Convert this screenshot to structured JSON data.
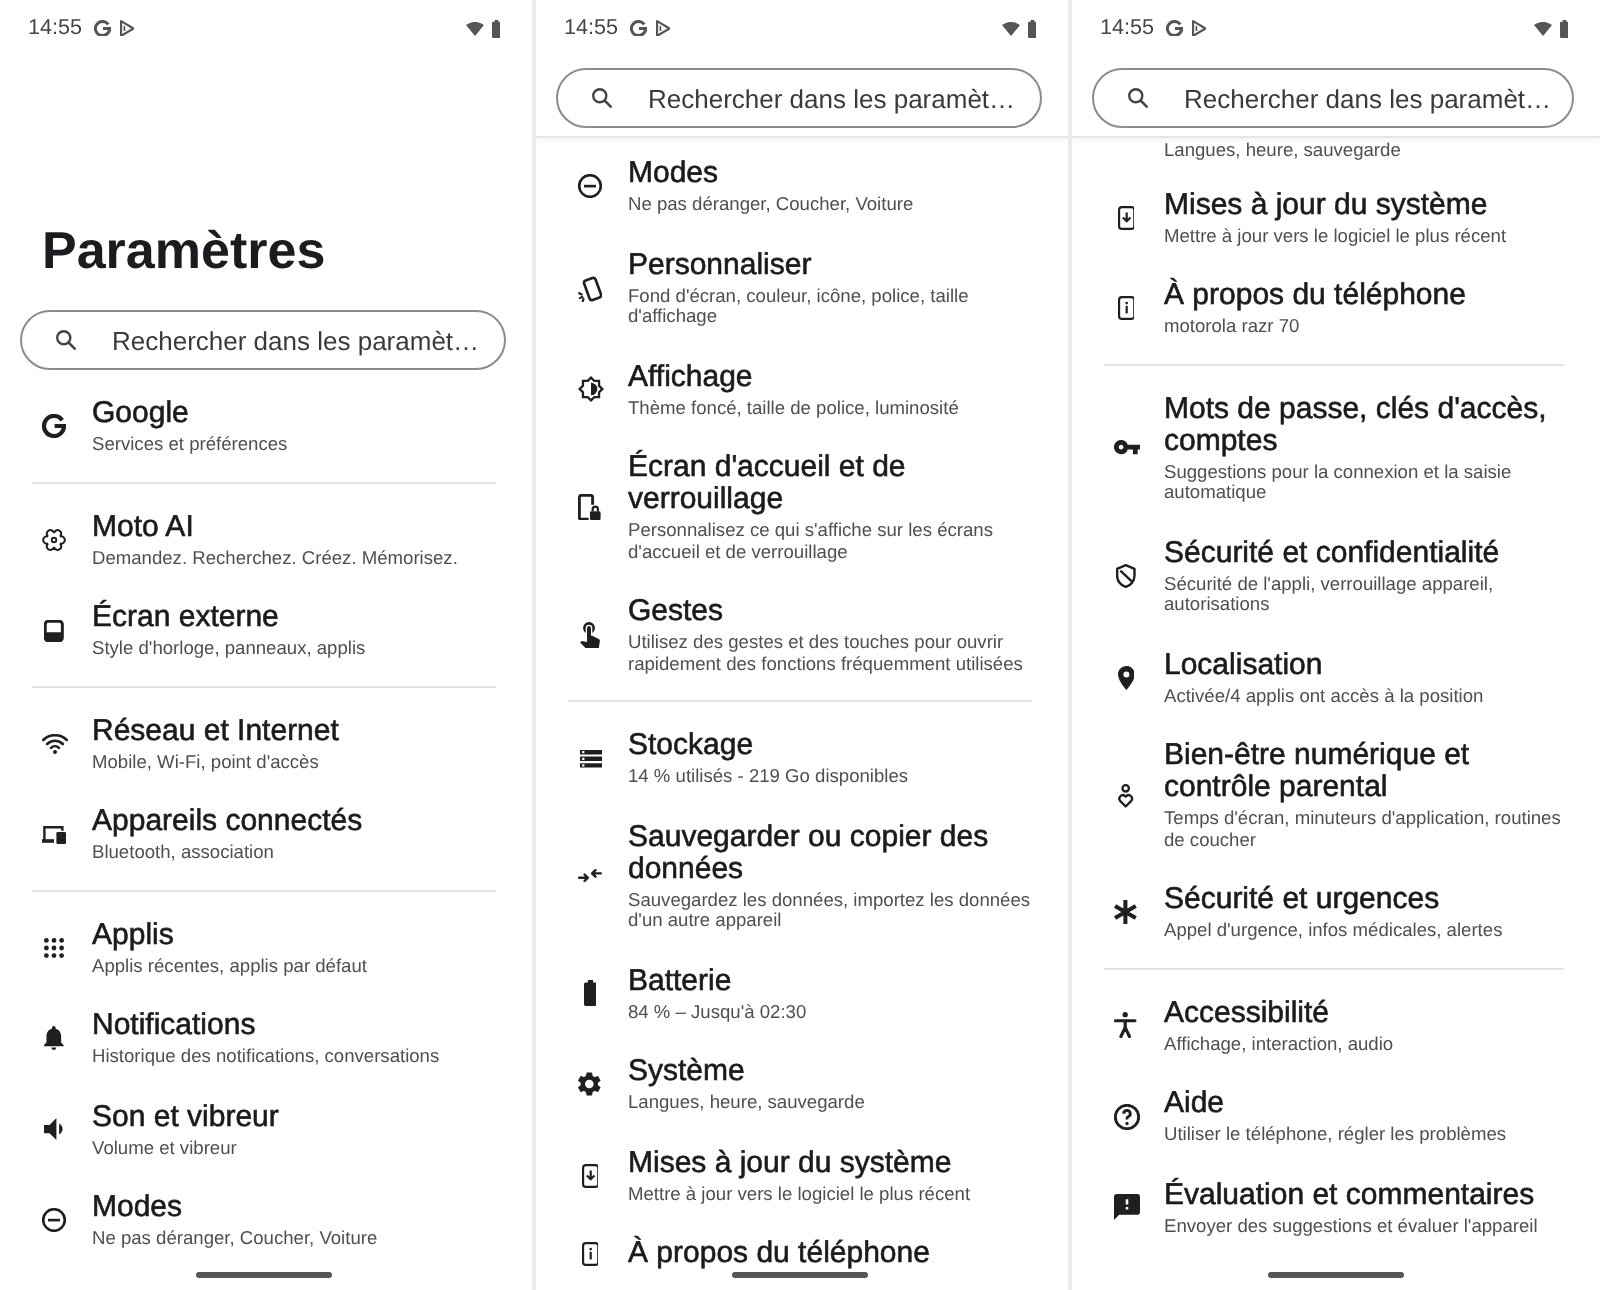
{
  "panels": [
    {
      "status_bar": {
        "time": "14:55"
      },
      "title": "Paramètres",
      "search": {
        "placeholder": "Rechercher dans les paramèt…"
      },
      "groups": [
        {
          "items": [
            {
              "kind": "google",
              "title": "Google",
              "subtitle": "Services et préférences"
            }
          ]
        },
        {
          "items": [
            {
              "kind": "ai",
              "title": "Moto AI",
              "subtitle": "Demandez. Recherchez. Créez. Mémorisez."
            },
            {
              "kind": "external_screen",
              "title": "Écran externe",
              "subtitle": "Style d'horloge, panneaux, applis"
            }
          ]
        },
        {
          "items": [
            {
              "kind": "network",
              "title": "Réseau et Internet",
              "subtitle": "Mobile, Wi-Fi, point d'accès"
            },
            {
              "kind": "devices",
              "title": "Appareils connectés",
              "subtitle": "Bluetooth, association"
            }
          ]
        },
        {
          "items": [
            {
              "kind": "apps",
              "title": "Applis",
              "subtitle": "Applis récentes, applis par défaut"
            },
            {
              "kind": "notifications",
              "title": "Notifications",
              "subtitle": "Historique des notifications, conversations"
            },
            {
              "kind": "sound",
              "title": "Son et vibreur",
              "subtitle": "Volume et vibreur"
            },
            {
              "kind": "modes",
              "title": "Modes",
              "subtitle": "Ne pas déranger, Coucher, Voiture"
            }
          ]
        }
      ]
    },
    {
      "status_bar": {
        "time": "14:55"
      },
      "search": {
        "placeholder": "Rechercher dans les paramèt…"
      },
      "groups": [
        {
          "items": [
            {
              "kind": "modes",
              "title": "Modes",
              "subtitle": "Ne pas déranger, Coucher, Voiture"
            },
            {
              "kind": "personalize",
              "title": "Personnaliser",
              "subtitle": "Fond d'écran, couleur, icône, police, taille d'affichage"
            },
            {
              "kind": "display",
              "title": "Affichage",
              "subtitle": "Thème foncé, taille de police, luminosité"
            },
            {
              "kind": "home_lock",
              "title": "Écran d'accueil et de verrouillage",
              "subtitle": "Personnalisez ce qui s'affiche sur les écrans d'accueil et de verrouillage"
            },
            {
              "kind": "gestures",
              "title": "Gestes",
              "subtitle": "Utilisez des gestes et des touches pour ouvrir rapidement des fonctions fréquemment utilisées"
            }
          ]
        },
        {
          "items": [
            {
              "kind": "storage",
              "title": "Stockage",
              "subtitle": "14 % utilisés - 219 Go disponibles"
            },
            {
              "kind": "backup",
              "title": "Sauvegarder ou copier des données",
              "subtitle": "Sauvegardez les données, importez les données d'un autre appareil"
            },
            {
              "kind": "battery",
              "title": "Batterie",
              "subtitle": "84 % – Jusqu'à 02:30"
            },
            {
              "kind": "system",
              "title": "Système",
              "subtitle": "Langues, heure, sauvegarde"
            },
            {
              "kind": "updates",
              "title": "Mises à jour du système",
              "subtitle": "Mettre à jour vers le logiciel le plus récent"
            },
            {
              "kind": "about",
              "title": "À propos du téléphone"
            }
          ]
        }
      ]
    },
    {
      "status_bar": {
        "time": "14:55"
      },
      "search": {
        "placeholder": "Rechercher dans les paramèt…"
      },
      "groups": [
        {
          "items": [
            {
              "subtitle": "Langues, heure, sauvegarde"
            },
            {
              "kind": "updates",
              "title": "Mises à jour du système",
              "subtitle": "Mettre à jour vers le logiciel le plus récent"
            },
            {
              "kind": "about",
              "title": "À propos du téléphone",
              "subtitle": "motorola razr 70"
            }
          ]
        },
        {
          "items": [
            {
              "kind": "passwords",
              "title": "Mots de passe, clés d'accès, comptes",
              "subtitle": "Suggestions pour la connexion et la saisie automatique"
            },
            {
              "kind": "security",
              "title": "Sécurité et confidentialité",
              "subtitle": "Sécurité de l'appli, verrouillage appareil, autorisations"
            },
            {
              "kind": "location",
              "title": "Localisation",
              "subtitle": "Activée/4 applis ont accès à la position"
            },
            {
              "kind": "wellbeing",
              "title": "Bien-être numérique et contrôle parental",
              "subtitle": "Temps d'écran, minuteurs d'application, routines de coucher"
            },
            {
              "kind": "emergency",
              "title": "Sécurité et urgences",
              "subtitle": "Appel d'urgence, infos médicales, alertes"
            }
          ]
        },
        {
          "items": [
            {
              "kind": "accessibility",
              "title": "Accessibilité",
              "subtitle": "Affichage, interaction, audio"
            },
            {
              "kind": "help",
              "title": "Aide",
              "subtitle": "Utiliser le téléphone, régler les problèmes"
            },
            {
              "kind": "feedback",
              "title": "Évaluation et commentaires",
              "subtitle": "Envoyer des suggestions et évaluer l'appareil"
            }
          ]
        }
      ]
    }
  ]
}
